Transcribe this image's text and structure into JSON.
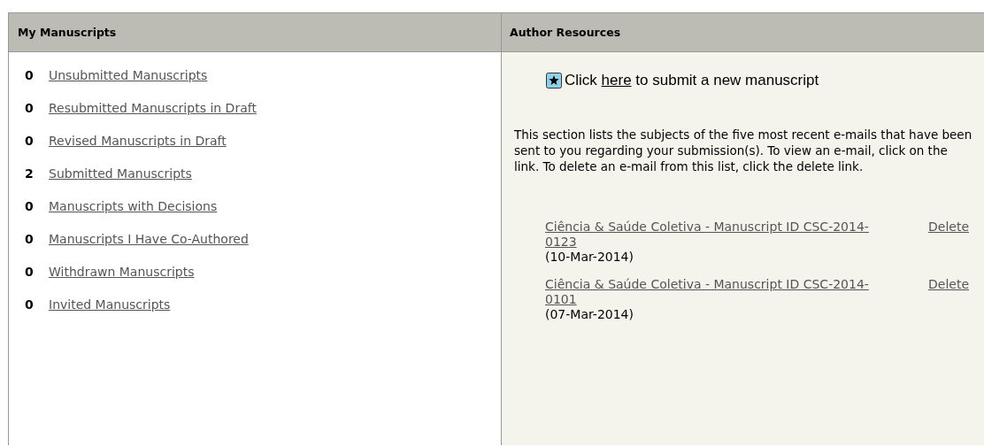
{
  "panels": [
    {
      "title": "My Manuscripts",
      "kind": "manuscripts",
      "items": [
        {
          "count": "0",
          "label": "Unsubmitted Manuscripts"
        },
        {
          "count": "0",
          "label": "Resubmitted Manuscripts in Draft"
        },
        {
          "count": "0",
          "label": "Revised Manuscripts in Draft"
        },
        {
          "count": "2",
          "label": "Submitted Manuscripts"
        },
        {
          "count": "0",
          "label": "Manuscripts with Decisions"
        },
        {
          "count": "0",
          "label": "Manuscripts I Have Co-Authored"
        },
        {
          "count": "0",
          "label": "Withdrawn Manuscripts"
        },
        {
          "count": "0",
          "label": "Invited Manuscripts"
        }
      ]
    },
    {
      "title": "Author Resources",
      "kind": "resources",
      "submit": {
        "before": "Click ",
        "link": "here",
        "after": " to submit a new manuscript"
      },
      "description": "This section lists the subjects of the five most recent e-mails that have been sent to you regarding your submission(s). To view an e-mail, click on the link. To delete an e-mail from this list, click the delete link.",
      "emails": [
        {
          "subject": "Ciência & Saúde Coletiva - Manuscript ID CSC-2014-0123 ",
          "date": "(10-Mar-2014)",
          "action": "Delete"
        },
        {
          "subject": "Ciência & Saúde Coletiva - Manuscript ID CSC-2014-0101 ",
          "date": "(07-Mar-2014)",
          "action": "Delete"
        }
      ]
    }
  ]
}
